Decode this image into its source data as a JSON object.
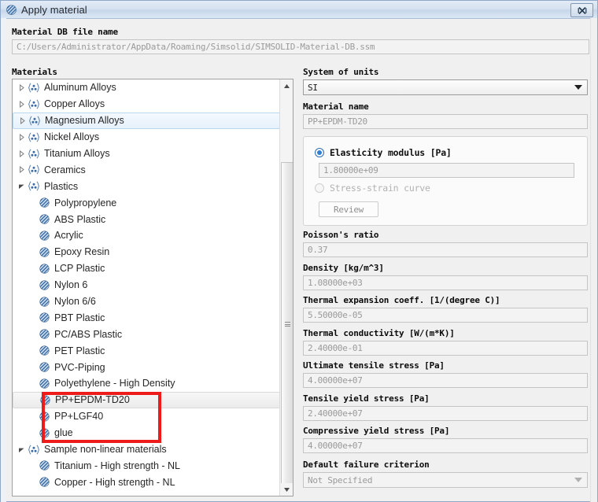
{
  "window": {
    "title": "Apply material",
    "icon": "striped-sphere-icon",
    "close_label": "✖"
  },
  "db_file": {
    "label": "Material DB file name",
    "value": "C:/Users/Administrator/AppData/Roaming/Simsolid/SIMSOLID-Material-DB.ssm"
  },
  "materials": {
    "label": "Materials",
    "tree": [
      {
        "label": "Aluminum Alloys",
        "type": "group",
        "expanded": false,
        "state": "normal"
      },
      {
        "label": "Copper Alloys",
        "type": "group",
        "expanded": false,
        "state": "normal"
      },
      {
        "label": "Magnesium Alloys",
        "type": "group",
        "expanded": false,
        "state": "hovered"
      },
      {
        "label": "Nickel Alloys",
        "type": "group",
        "expanded": false,
        "state": "normal"
      },
      {
        "label": "Titanium Alloys",
        "type": "group",
        "expanded": false,
        "state": "normal"
      },
      {
        "label": "Ceramics",
        "type": "group",
        "expanded": false,
        "state": "normal"
      },
      {
        "label": "Plastics",
        "type": "group",
        "expanded": true,
        "state": "normal"
      },
      {
        "label": "Polypropylene",
        "type": "leaf",
        "state": "normal"
      },
      {
        "label": "ABS Plastic",
        "type": "leaf",
        "state": "normal"
      },
      {
        "label": "Acrylic",
        "type": "leaf",
        "state": "normal"
      },
      {
        "label": "Epoxy Resin",
        "type": "leaf",
        "state": "normal"
      },
      {
        "label": "LCP Plastic",
        "type": "leaf",
        "state": "normal"
      },
      {
        "label": "Nylon 6",
        "type": "leaf",
        "state": "normal"
      },
      {
        "label": "Nylon 6/6",
        "type": "leaf",
        "state": "normal"
      },
      {
        "label": "PBT Plastic",
        "type": "leaf",
        "state": "normal"
      },
      {
        "label": "PC/ABS Plastic",
        "type": "leaf",
        "state": "normal"
      },
      {
        "label": "PET Plastic",
        "type": "leaf",
        "state": "normal"
      },
      {
        "label": "PVC-Piping",
        "type": "leaf",
        "state": "normal"
      },
      {
        "label": "Polyethylene - High Density",
        "type": "leaf",
        "state": "normal"
      },
      {
        "label": "PP+EPDM-TD20",
        "type": "leaf",
        "state": "selected"
      },
      {
        "label": "PP+LGF40",
        "type": "leaf",
        "state": "normal"
      },
      {
        "label": "glue",
        "type": "leaf",
        "state": "normal"
      },
      {
        "label": "Sample non-linear materials",
        "type": "group",
        "expanded": true,
        "state": "normal"
      },
      {
        "label": "Titanium - High strength - NL",
        "type": "leaf",
        "state": "normal"
      },
      {
        "label": "Copper - High strength - NL",
        "type": "leaf",
        "state": "normal"
      }
    ]
  },
  "properties": {
    "units": {
      "label": "System of units",
      "value": "SI"
    },
    "material_name": {
      "label": "Material name",
      "value": "PP+EPDM-TD20"
    },
    "elasticity": {
      "modulus_label": "Elasticity modulus [Pa]",
      "modulus_value": "1.80000e+09",
      "modulus_selected": true,
      "curve_label": "Stress-strain curve",
      "curve_selected": false,
      "review_label": "Review"
    },
    "fields": [
      {
        "label": "Poisson's ratio",
        "value": "0.37"
      },
      {
        "label": "Density [kg/m^3]",
        "value": "1.08000e+03"
      },
      {
        "label": "Thermal expansion coeff. [1/(degree C)]",
        "value": "5.50000e-05"
      },
      {
        "label": "Thermal conductivity [W/(m*K)]",
        "value": "2.40000e-01"
      },
      {
        "label": "Ultimate tensile stress [Pa]",
        "value": "4.00000e+07"
      },
      {
        "label": "Tensile yield stress [Pa]",
        "value": "2.40000e+07"
      },
      {
        "label": "Compressive yield stress [Pa]",
        "value": "4.00000e+07"
      }
    ],
    "failure": {
      "label": "Default failure criterion",
      "value": "Not Specified"
    }
  },
  "annotation": {
    "color": "#ee1b1b",
    "shape": "rectangle"
  },
  "colors": {
    "titlebar": "#d5e2f0",
    "accent": "#2f7fd4",
    "highlight": "#e6f1fb",
    "annotation_red": "#ee1b1b"
  }
}
